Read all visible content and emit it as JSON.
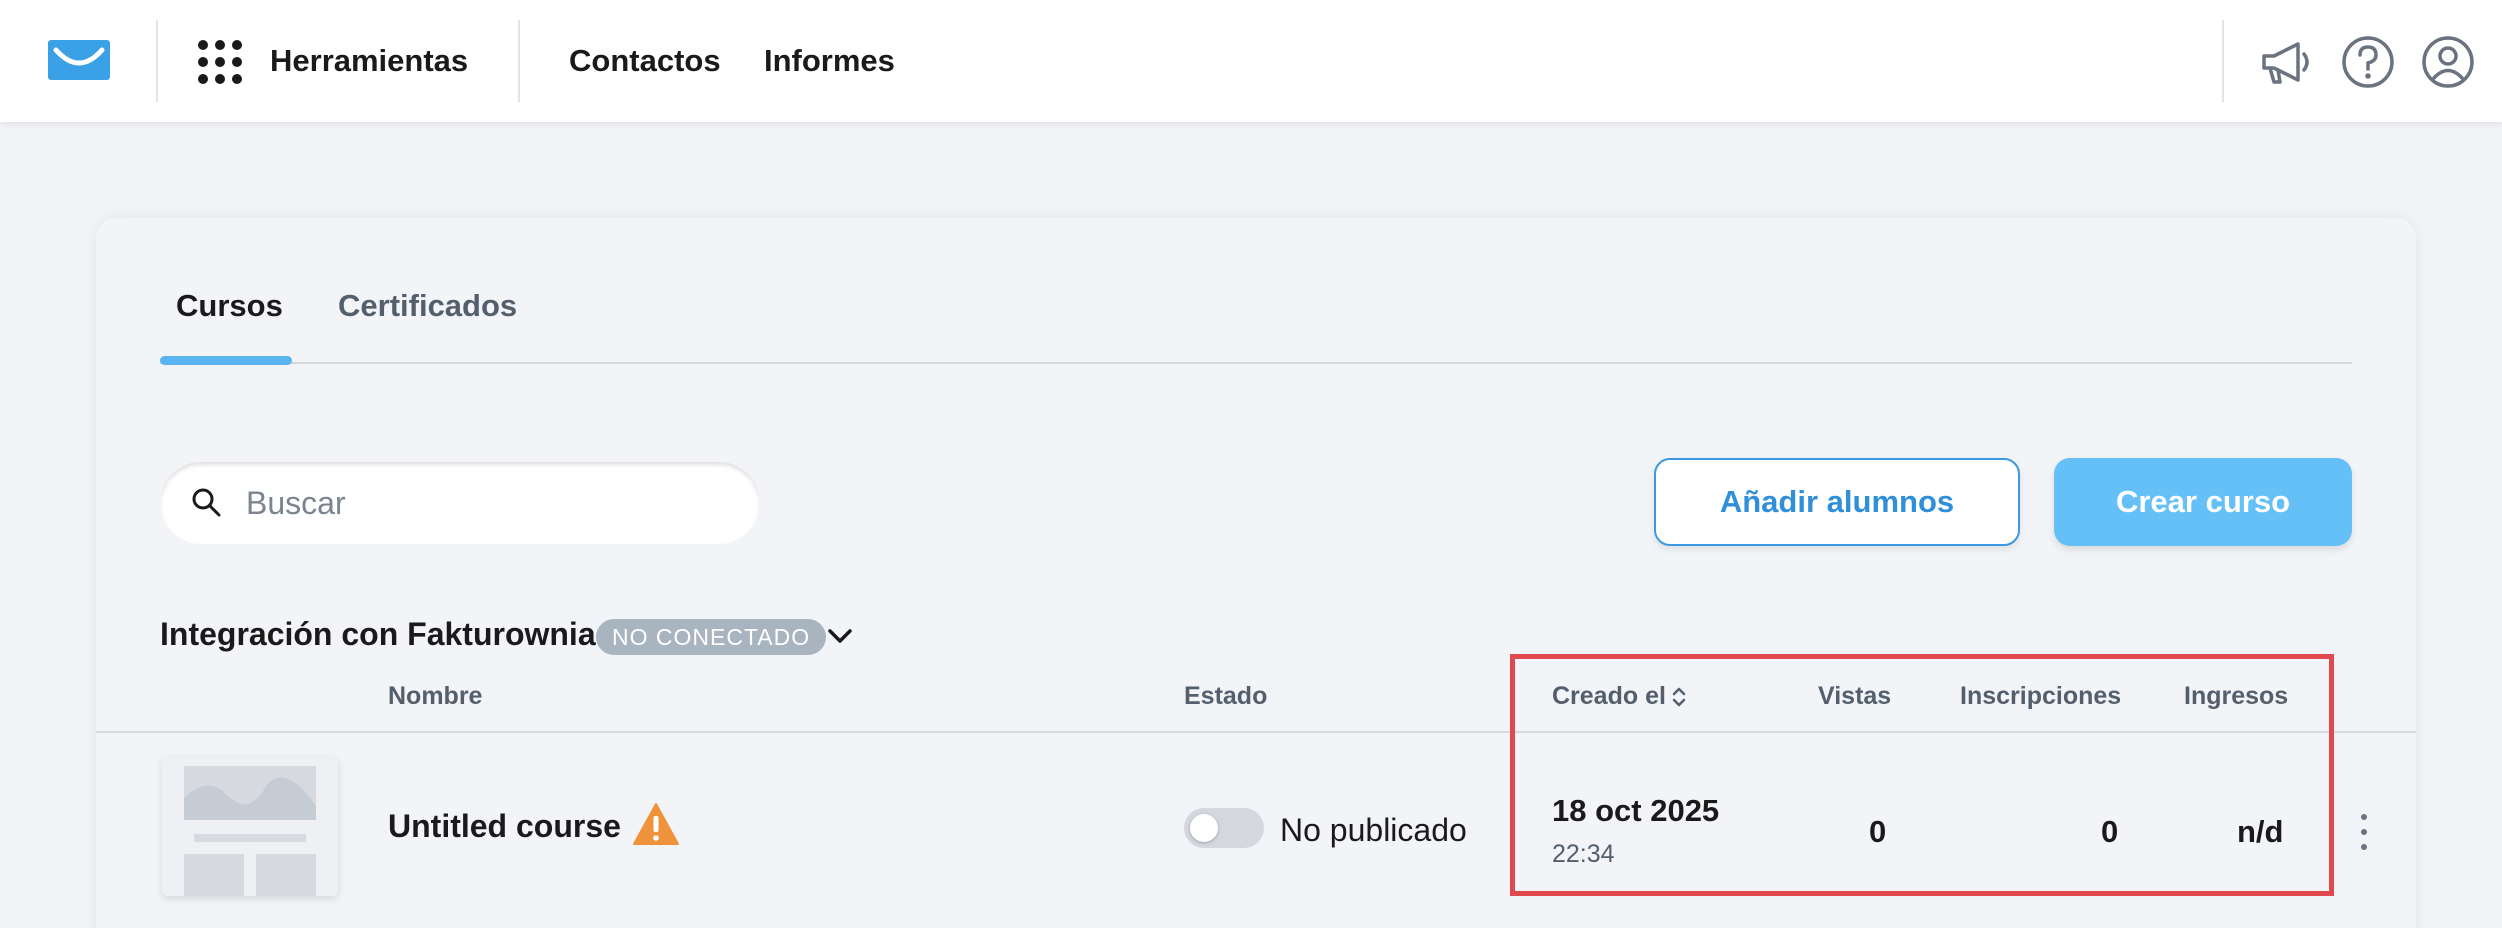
{
  "topbar": {
    "logo_icon": "envelope-logo-icon",
    "tools_label": "Herramientas",
    "nav": [
      "Contactos",
      "Informes"
    ],
    "icons": [
      "megaphone-icon",
      "help-icon",
      "user-profile-icon"
    ]
  },
  "tabs": [
    {
      "label": "Cursos",
      "active": true
    },
    {
      "label": "Certificados",
      "active": false
    }
  ],
  "search": {
    "placeholder": "Buscar",
    "value": ""
  },
  "buttons": {
    "add_students": "Añadir alumnos",
    "create_course": "Crear curso"
  },
  "integration": {
    "label": "Integración con Fakturownia",
    "badge": "NO CONECTADO"
  },
  "table": {
    "headers": {
      "name": "Nombre",
      "status": "Estado",
      "created": "Creado el",
      "views": "Vistas",
      "enrollments": "Inscripciones",
      "revenue": "Ingresos"
    },
    "rows": [
      {
        "name": "Untitled course",
        "status": "No publicado",
        "published": false,
        "created_date": "18 oct 2025",
        "created_time": "22:34",
        "views": "0",
        "enrollments": "0",
        "revenue": "n/d"
      }
    ]
  },
  "colors": {
    "accent": "#5ab4f0",
    "primary_button": "#64c0f6",
    "warning": "#f0923a",
    "highlight": "#e04a4f",
    "badge": "#a9b4c1"
  }
}
